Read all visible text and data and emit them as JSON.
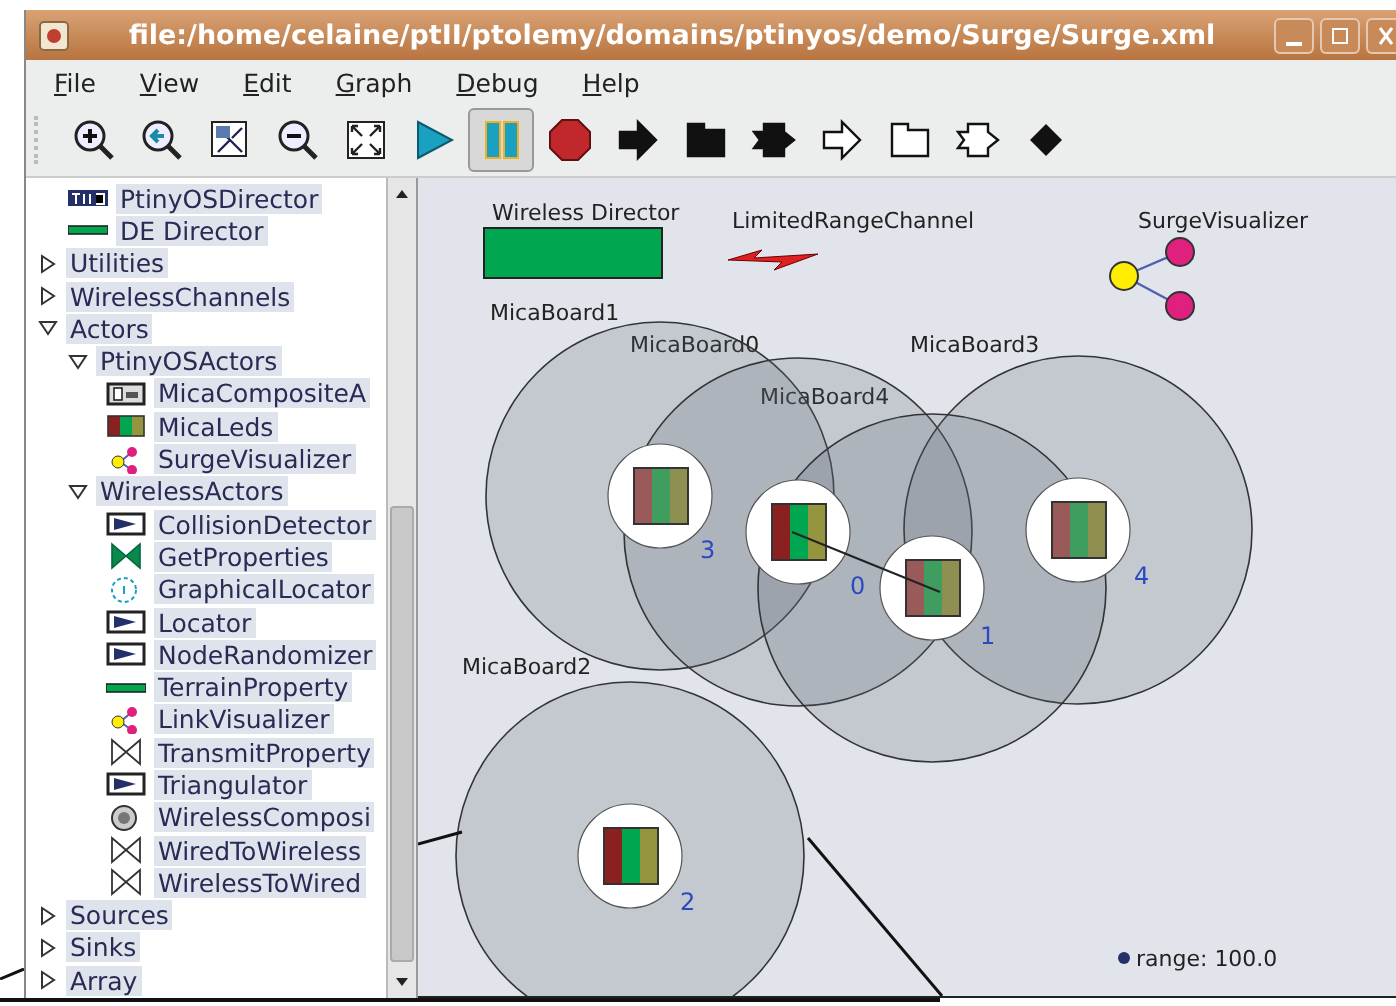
{
  "window": {
    "title": "file:/home/celaine/ptII/ptolemy/domains/ptinyos/demo/Surge/Surge.xml"
  },
  "menu": [
    "File",
    "View",
    "Edit",
    "Graph",
    "Debug",
    "Help"
  ],
  "toolbar": [
    {
      "kind": "zoomin",
      "selected": false
    },
    {
      "kind": "zoomreset",
      "selected": false
    },
    {
      "kind": "zoomfit",
      "selected": false
    },
    {
      "kind": "zoomout",
      "selected": false
    },
    {
      "kind": "fullscreen",
      "selected": false
    },
    {
      "kind": "run",
      "selected": false
    },
    {
      "kind": "pause",
      "selected": true
    },
    {
      "kind": "stop",
      "selected": false
    },
    {
      "kind": "arrow",
      "selected": false
    },
    {
      "kind": "flag",
      "selected": false
    },
    {
      "kind": "notch",
      "selected": false
    },
    {
      "kind": "outlinearrow",
      "selected": false
    },
    {
      "kind": "outlineflag",
      "selected": false
    },
    {
      "kind": "outlinenotch",
      "selected": false
    },
    {
      "kind": "diamond",
      "selected": false
    }
  ],
  "library": [
    {
      "label": "PtinyOSDirector",
      "kind": "badge"
    },
    {
      "label": "DE Director",
      "kind": "bar"
    },
    {
      "label": "Utilities",
      "kind": "folder",
      "expanded": false
    },
    {
      "label": "WirelessChannels",
      "kind": "folder",
      "expanded": false
    },
    {
      "label": "Actors",
      "kind": "folder",
      "expanded": true,
      "children": [
        {
          "label": "PtinyOSActors",
          "kind": "folder",
          "expanded": true,
          "children": [
            {
              "label": "MicaCompositeA",
              "kind": "composite"
            },
            {
              "label": "MicaLeds",
              "kind": "leds"
            },
            {
              "label": "SurgeVisualizer",
              "kind": "graph"
            }
          ]
        },
        {
          "label": "WirelessActors",
          "kind": "folder",
          "expanded": true,
          "children": [
            {
              "label": "CollisionDetector",
              "kind": "flagbox"
            },
            {
              "label": "GetProperties",
              "kind": "bowtie"
            },
            {
              "label": "GraphicalLocator",
              "kind": "dial"
            },
            {
              "label": "Locator",
              "kind": "flagbox"
            },
            {
              "label": "NodeRandomizer",
              "kind": "flagbox"
            },
            {
              "label": "TerrainProperty",
              "kind": "bar"
            },
            {
              "label": "LinkVisualizer",
              "kind": "graph"
            },
            {
              "label": "TransmitProperty",
              "kind": "hourglass"
            },
            {
              "label": "Triangulator",
              "kind": "flagbox"
            },
            {
              "label": "WirelessComposi",
              "kind": "disc"
            },
            {
              "label": "WiredToWireless",
              "kind": "hourglass"
            },
            {
              "label": "WirelessToWired",
              "kind": "hourglass"
            }
          ]
        }
      ]
    },
    {
      "label": "Sources",
      "kind": "folder",
      "expanded": false
    },
    {
      "label": "Sinks",
      "kind": "folder",
      "expanded": false
    },
    {
      "label": "Array",
      "kind": "folder",
      "expanded": false
    }
  ],
  "diagram": {
    "director": "Wireless Director",
    "channel": "LimitedRangeChannel",
    "visualizer": "SurgeVisualizer",
    "nodes": [
      {
        "label": "MicaBoard1",
        "number": "3",
        "active": false
      },
      {
        "label": "MicaBoard0",
        "number": "0",
        "active": true
      },
      {
        "label": "MicaBoard3",
        "number": "4",
        "active": false
      },
      {
        "label": "MicaBoard4",
        "number": "1",
        "active": false
      },
      {
        "label": "MicaBoard2",
        "number": "2",
        "active": true
      }
    ],
    "range": "range: 100.0"
  }
}
